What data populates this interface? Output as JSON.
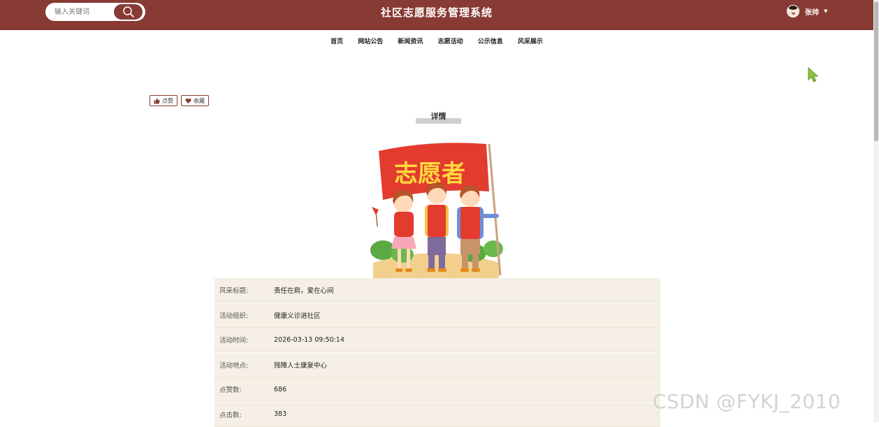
{
  "header": {
    "search_placeholder": "输入关键词",
    "site_title": "社区志愿服务管理系统",
    "user_name": "张帅"
  },
  "nav": {
    "items": [
      "首页",
      "网站公告",
      "新闻资讯",
      "志愿活动",
      "公示信息",
      "风采展示"
    ]
  },
  "actions": {
    "like_label": "点赞",
    "favorite_label": "收藏"
  },
  "detail": {
    "title": "详情",
    "banner_text": "志愿者",
    "rows": [
      {
        "label": "风采标题:",
        "value": "责任在肩，爱在心间"
      },
      {
        "label": "活动组织:",
        "value": "健康义诊进社区"
      },
      {
        "label": "活动时间:",
        "value": "2026-03-13 09:50:14"
      },
      {
        "label": "活动地点:",
        "value": "残障人士康复中心"
      },
      {
        "label": "点赞数:",
        "value": "686"
      },
      {
        "label": "点击数:",
        "value": "383"
      }
    ]
  },
  "watermark": "CSDN @FYKJ_2010",
  "colors": {
    "brand": "#883a34",
    "row_bg": "#f5efe5"
  }
}
